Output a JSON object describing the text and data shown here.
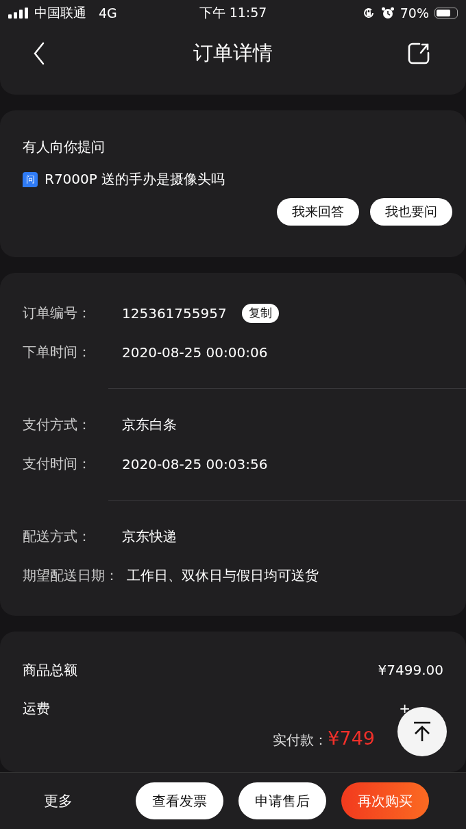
{
  "status_bar": {
    "carrier": "中国联通",
    "network": "4G",
    "time": "下午 11:57",
    "battery": "70%"
  },
  "header": {
    "title": "订单详情"
  },
  "question": {
    "heading": "有人向你提问",
    "badge": "问",
    "text": "R7000P 送的手办是摄像头吗",
    "buttons": [
      "我来回答",
      "我也要问"
    ]
  },
  "order_groups": [
    {
      "rows": [
        {
          "label": "订单编号：",
          "value": "125361755957",
          "action": "复制"
        },
        {
          "label": "下单时间：",
          "value": "2020-08-25 00:00:06"
        }
      ]
    },
    {
      "rows": [
        {
          "label": "支付方式：",
          "value": "京东白条"
        },
        {
          "label": "支付时间：",
          "value": "2020-08-25 00:03:56"
        }
      ]
    },
    {
      "rows": [
        {
          "label": "配送方式：",
          "value": "京东快递"
        },
        {
          "label": "期望配送日期：",
          "value": "工作日、双休日与假日均可送货"
        }
      ]
    }
  ],
  "totals": {
    "rows": [
      {
        "label": "商品总额",
        "value": "¥7499.00"
      },
      {
        "label": "运费",
        "value": "+"
      }
    ],
    "paid_label": "实付款：",
    "paid_value": "¥749"
  },
  "bottom_bar": {
    "more": "更多",
    "buttons": [
      {
        "label": "查看发票",
        "kind": "outline"
      },
      {
        "label": "申请售后",
        "kind": "outline"
      },
      {
        "label": "再次购买",
        "kind": "primary"
      }
    ]
  }
}
